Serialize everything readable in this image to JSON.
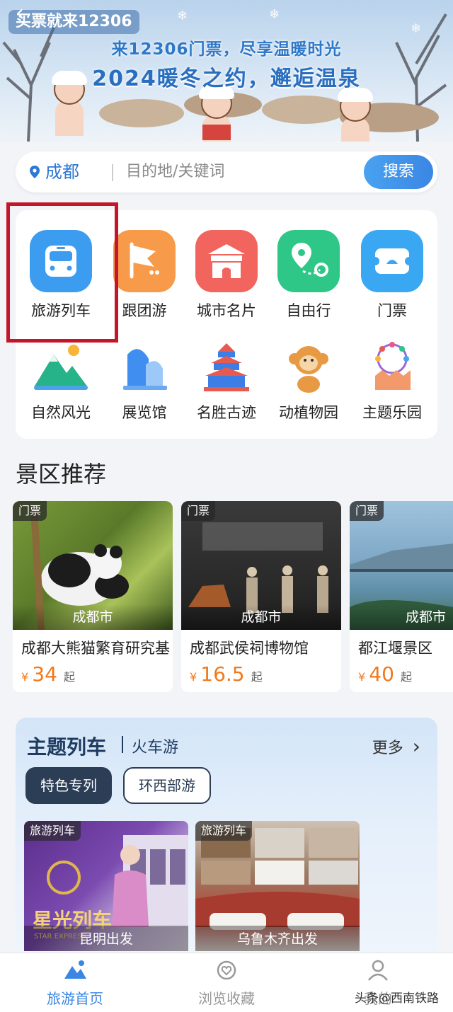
{
  "banner": {
    "back_title": "买票就来12306",
    "line1": "来12306门票，尽享温暖时光",
    "line2": "2024暖冬之约，邂逅温泉"
  },
  "search": {
    "city": "成都",
    "placeholder": "目的地/关键词",
    "button": "搜索"
  },
  "categories": [
    {
      "label": "旅游列车",
      "icon": "train-icon",
      "color": "#3b9cf0"
    },
    {
      "label": "跟团游",
      "icon": "flag-icon",
      "color": "#f79a4a"
    },
    {
      "label": "城市名片",
      "icon": "city-gate-icon",
      "color": "#f2645e"
    },
    {
      "label": "自由行",
      "icon": "map-pin-icon",
      "color": "#2fc787"
    },
    {
      "label": "门票",
      "icon": "ticket-icon",
      "color": "#3aa7f2"
    },
    {
      "label": "自然风光",
      "icon": "mountain-icon"
    },
    {
      "label": "展览馆",
      "icon": "museum-icon"
    },
    {
      "label": "名胜古迹",
      "icon": "temple-icon"
    },
    {
      "label": "动植物园",
      "icon": "monkey-icon"
    },
    {
      "label": "主题乐园",
      "icon": "ferris-wheel-icon"
    }
  ],
  "scenic": {
    "title": "景区推荐",
    "items": [
      {
        "tag": "门票",
        "city": "成都市",
        "name": "成都大熊猫繁育研究基地",
        "currency": "¥",
        "price": "34",
        "suffix": "起"
      },
      {
        "tag": "门票",
        "city": "成都市",
        "name": "成都武侯祠博物馆",
        "currency": "¥",
        "price": "16.5",
        "suffix": "起"
      },
      {
        "tag": "门票",
        "city": "成都市",
        "name": "都江堰景区",
        "currency": "¥",
        "price": "40",
        "suffix": "起"
      }
    ]
  },
  "theme": {
    "title": "主题列车",
    "subtitle": "火车游",
    "more": "更多",
    "tabs": [
      "特色专列",
      "环西部游"
    ],
    "trains": [
      {
        "tag": "旅游列车",
        "depart": "昆明出发",
        "brand": "星光列车",
        "brand_en": "STAR EXPRESS"
      },
      {
        "tag": "旅游列车",
        "depart": "乌鲁木齐出发"
      }
    ]
  },
  "nav": [
    {
      "label": "旅游首页",
      "icon": "home-mountain-icon",
      "active": true
    },
    {
      "label": "浏览收藏",
      "icon": "favorite-icon",
      "active": false
    },
    {
      "label": "我的",
      "icon": "user-icon",
      "active": false
    }
  ],
  "watermark": "头条@西南铁路",
  "colors": {
    "accent": "#3a86e4",
    "price": "#f0791c",
    "highlight": "#c4162a",
    "theme_dark": "#2c3d56"
  }
}
